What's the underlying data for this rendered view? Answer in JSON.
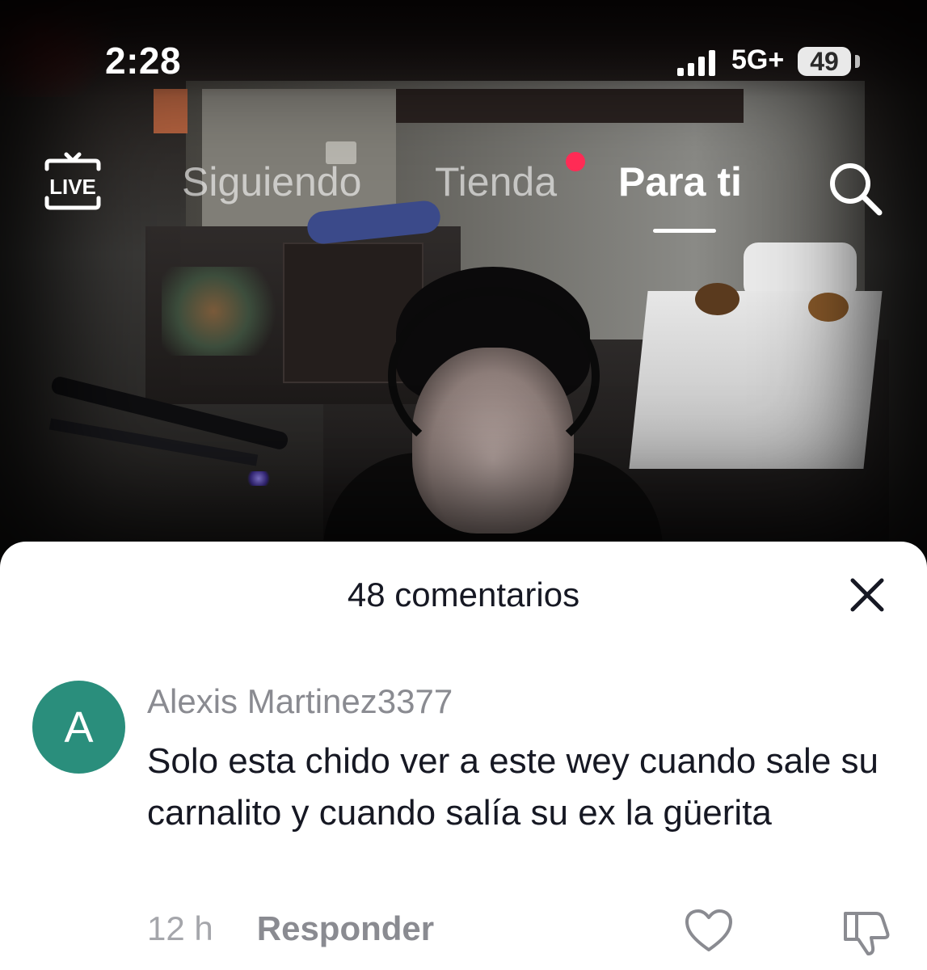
{
  "status_bar": {
    "time": "2:28",
    "network": "5G+",
    "battery": "49"
  },
  "nav": {
    "live_label": "LIVE",
    "tabs": [
      {
        "label": "Siguiendo",
        "active": false
      },
      {
        "label": "Tienda",
        "active": false,
        "notification_dot": true
      },
      {
        "label": "Para ti",
        "active": true
      }
    ],
    "search_icon": "search-icon"
  },
  "comments_sheet": {
    "title": "48 comentarios",
    "close_icon": "close-icon",
    "comments": [
      {
        "avatar_letter": "A",
        "avatar_color": "#2a8e7c",
        "username": "Alexis Martinez3377",
        "text": "Solo esta chido ver a este wey cuando sale su carnalito y cuando salía su ex la güerita",
        "time": "12 h",
        "reply_label": "Responder"
      }
    ]
  },
  "colors": {
    "accent_dot": "#ff2b55",
    "sheet_bg": "#ffffff",
    "text_primary": "#161823",
    "text_secondary": "#8a8b91"
  }
}
